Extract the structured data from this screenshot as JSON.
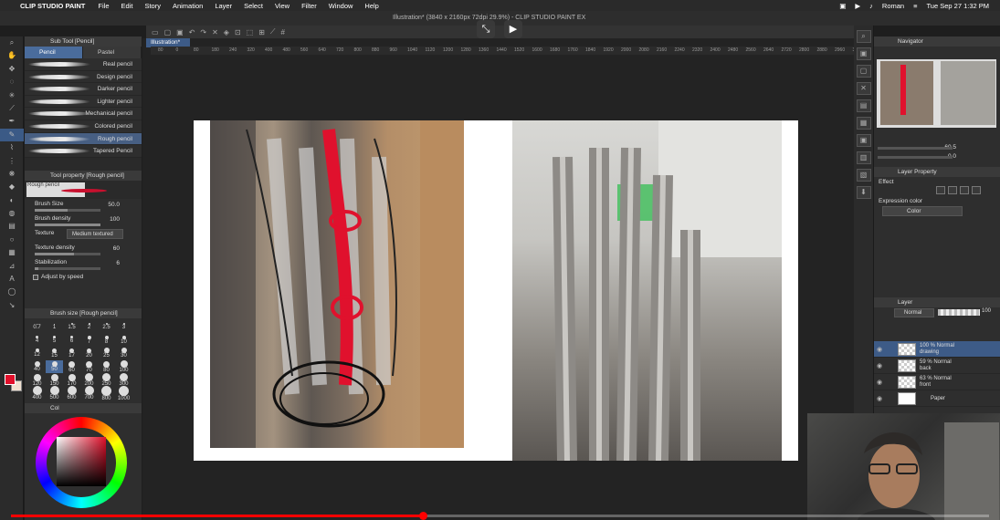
{
  "menubar": {
    "app_name": "CLIP STUDIO PAINT",
    "items": [
      "File",
      "Edit",
      "Story",
      "Animation",
      "Layer",
      "Select",
      "View",
      "Filter",
      "Window",
      "Help"
    ],
    "user": "Roman",
    "datetime": "Tue Sep 27  1:32 PM"
  },
  "window": {
    "title": "Illustration* (3840 x 2160px 72dpi 29.9%) - CLIP STUDIO PAINT EX"
  },
  "document_tab": "Illustration*",
  "ruler_ticks": [
    "80",
    "0",
    "80",
    "180",
    "240",
    "320",
    "400",
    "480",
    "560",
    "640",
    "720",
    "800",
    "880",
    "960",
    "1040",
    "1120",
    "1200",
    "1280",
    "1360",
    "1440",
    "1520",
    "1600",
    "1680",
    "1760",
    "1840",
    "1920",
    "2000",
    "2080",
    "2160",
    "2240",
    "2320",
    "2400",
    "2480",
    "2560",
    "2640",
    "2720",
    "2800",
    "2880",
    "2960",
    "3040"
  ],
  "sub_tool": {
    "header": "Sub Tool [Pencil]",
    "tabs": [
      "Pencil",
      "Pastel"
    ],
    "brushes": [
      "Real pencil",
      "Design pencil",
      "Darker pencil",
      "Lighter pencil",
      "Mechanical pencil",
      "Colored pencil",
      "Rough pencil",
      "Tapered Pencil"
    ],
    "selected_brush": "Rough pencil"
  },
  "tool_property": {
    "header": "Tool property [Rough pencil]",
    "preview_label": "Rough pencil",
    "brush_size_label": "Brush Size",
    "brush_size_value": "50.0",
    "brush_density_label": "Brush density",
    "brush_density_value": "100",
    "texture_label": "Texture",
    "texture_value": "Medium textured",
    "texture_density_label": "Texture density",
    "texture_density_value": "60",
    "stabilization_label": "Stabilization",
    "stabilization_value": "6",
    "adjust_by_speed_label": "Adjust by speed"
  },
  "brush_size_panel": {
    "header": "Brush size [Rough pencil]",
    "sizes": [
      "0.7",
      "1",
      "1.5",
      "2",
      "2.5",
      "3",
      "4",
      "5",
      "6",
      "7",
      "8",
      "10",
      "12",
      "15",
      "17",
      "20",
      "25",
      "30",
      "40",
      "50",
      "60",
      "70",
      "80",
      "100",
      "120",
      "150",
      "170",
      "200",
      "250",
      "300",
      "400",
      "500",
      "600",
      "700",
      "800",
      "1000"
    ],
    "selected": "50"
  },
  "color_panel": {
    "tab": "Col",
    "main_color": "#e10f2a",
    "sub_color": "#f0e0d0"
  },
  "navigator": {
    "header": "Navigator",
    "zoom_value": "60.5",
    "angle_value": "0.0"
  },
  "layer_property": {
    "header": "Layer Property",
    "effect_label": "Effect",
    "expression_color_label": "Expression color",
    "expression_color_value": "Color"
  },
  "layers": {
    "header": "Layer",
    "blend_mode": "Normal",
    "opacity": "100",
    "items": [
      {
        "line1": "100 % Normal",
        "line2": "drawing"
      },
      {
        "line1": "59 % Normal",
        "line2": "back"
      },
      {
        "line1": "63 % Normal",
        "line2": "front"
      },
      {
        "line1": "",
        "line2": "Paper"
      }
    ]
  },
  "video": {
    "progress_percent": 42.4,
    "accent": "#ff0000"
  }
}
